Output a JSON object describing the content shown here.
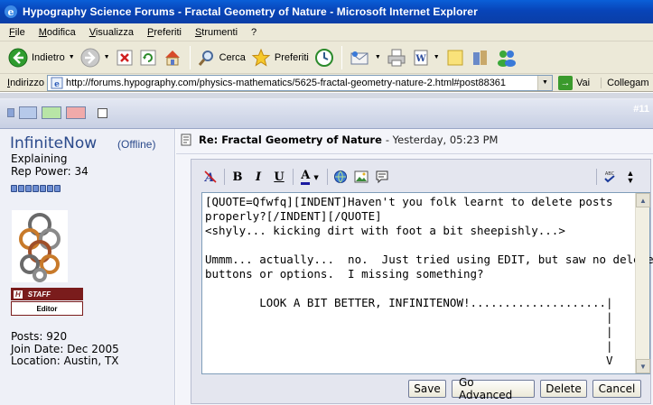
{
  "window": {
    "title": "Hypography Science Forums - Fractal Geometry of Nature - Microsoft Internet Explorer"
  },
  "menu": [
    "File",
    "Modifica",
    "Visualizza",
    "Preferiti",
    "Strumenti",
    "?"
  ],
  "toolbar": {
    "back_label": "Indietro",
    "search_label": "Cerca",
    "favorites_label": "Preferiti"
  },
  "address": {
    "label": "Indirizzo",
    "url": "http://forums.hypography.com/physics-mathematics/5625-fractal-geometry-nature-2.html#post88361",
    "go_label": "Vai",
    "links_label": "Collegam"
  },
  "forum": {
    "post_number": "#11"
  },
  "user": {
    "name": "InfiniteNow",
    "status": "(Offline)",
    "title": "Explaining",
    "rep_power": "Rep Power: 34",
    "rep_level": 7,
    "staff_label": "STAFF",
    "staff_mark": "H",
    "role_label": "Editor",
    "posts": "Posts: 920",
    "join_date": "Join Date: Dec 2005",
    "location": "Location: Austin, TX"
  },
  "post": {
    "title": "Re: Fractal Geometry of Nature",
    "date": "- Yesterday, 05:23 PM"
  },
  "editor": {
    "bold": "B",
    "italic": "I",
    "underline": "U",
    "font_color": "A",
    "content": "[QUOTE=Qfwfq][INDENT]Haven't you folk learnt to delete posts\nproperly?[/INDENT][/QUOTE]\n<shyly... kicking dirt with foot a bit sheepishly...>\n\nUmmm... actually...  no.  Just tried using EDIT, but saw no delete\nbuttons or options.  I missing something?\n\n        LOOK A BIT BETTER, INFINITENOW!....................|\n                                                           |\n                                                           |\n                                                           |\n                                                           V",
    "buttons": {
      "save": "Save",
      "advanced": "Go Advanced",
      "delete": "Delete",
      "cancel": "Cancel"
    }
  },
  "colors": {
    "titlebar": "#0a4fc8",
    "username": "#2b4a8b",
    "staff": "#7a1c1c"
  }
}
